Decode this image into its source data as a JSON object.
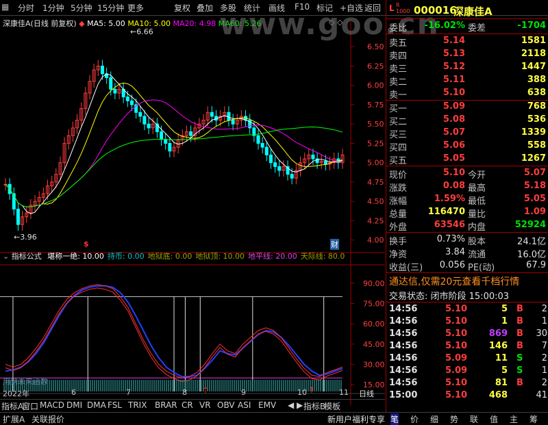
{
  "toolbar": {
    "items": [
      "分时",
      "1分钟",
      "5分钟",
      "15分钟",
      "更多",
      "复权",
      "叠加",
      "多股",
      "统计",
      "画线",
      "F10",
      "标记",
      "+自选",
      "返回"
    ]
  },
  "watermark": "www.goo.cn",
  "chart_header": {
    "stock": "深康佳A",
    "mode": "(日线 前复权)",
    "ma5": "MA5: 5.00",
    "ma10": "MA10: 5.00",
    "ma20": "MA20: 4.98",
    "ma60": "MA60: 5.26"
  },
  "annotations": {
    "high": "6.66",
    "low": "3.96",
    "marker_s": "$",
    "marker_cai": "财"
  },
  "indicator_header": {
    "title": "指标公式",
    "params": [
      {
        "text": "堪称一绝: 10.00",
        "color": "#ffffff"
      },
      {
        "text": "持币: 0.00",
        "color": "#00c8c8"
      },
      {
        "text": "地狱底: 0.00",
        "color": "#a0a000"
      },
      {
        "text": "地狱顶: 10.00",
        "color": "#a0a000"
      },
      {
        "text": "地平线: 20.00",
        "color": "#e040e0"
      },
      {
        "text": "天际线: 80.0",
        "color": "#a0a000"
      }
    ],
    "subtext": "用到未来函数"
  },
  "x_axis": {
    "year": "2022年",
    "months": [
      "6",
      "7",
      "8",
      "9",
      "10",
      "11"
    ],
    "period": "日线"
  },
  "chart_data": [
    {
      "type": "candlestick",
      "title": "深康佳A (日线 前复权)",
      "ylim": [
        3.9,
        6.75
      ],
      "y_ticks": [
        4.0,
        4.25,
        4.5,
        4.75,
        5.0,
        5.25,
        5.5,
        5.75,
        6.0,
        6.25,
        6.5
      ],
      "close": [
        4.72,
        4.6,
        4.4,
        4.2,
        4.3,
        4.35,
        4.45,
        4.5,
        4.55,
        4.6,
        4.7,
        4.75,
        4.85,
        5.0,
        5.25,
        5.35,
        5.45,
        5.55,
        5.7,
        5.9,
        6.05,
        6.2,
        6.25,
        6.15,
        6.1,
        5.95,
        5.9,
        5.95,
        5.85,
        5.8,
        5.75,
        5.65,
        5.6,
        5.5,
        5.45,
        5.5,
        5.4,
        5.3,
        5.25,
        5.15,
        5.2,
        5.3,
        5.35,
        5.4,
        5.35,
        5.45,
        5.5,
        5.55,
        5.65,
        5.6,
        5.55,
        5.6,
        5.65,
        5.55,
        5.5,
        5.55,
        5.6,
        5.55,
        5.45,
        5.35,
        5.25,
        5.2,
        5.1,
        5.0,
        4.95,
        4.9,
        4.95,
        4.85,
        4.8,
        4.9,
        5.0,
        5.05,
        5.1,
        5.05,
        5.0,
        5.02,
        4.98,
        5.0,
        5.05,
        5.0,
        5.1
      ],
      "series": [
        {
          "name": "MA5",
          "color": "#ffffff"
        },
        {
          "name": "MA10",
          "color": "#ffff00"
        },
        {
          "name": "MA20",
          "color": "#ff00ff"
        },
        {
          "name": "MA60",
          "color": "#00ff00"
        }
      ]
    },
    {
      "type": "line",
      "title": "指标公式",
      "ylim": [
        10,
        100
      ],
      "y_ticks": [
        15.0,
        30.0,
        45.0,
        60.0,
        75.0,
        90.0
      ],
      "hlines": [
        {
          "value": 80,
          "color": "#c0c0c0"
        },
        {
          "value": 20,
          "color": "#e040e0"
        }
      ],
      "k": [
        30,
        28,
        30,
        35,
        42,
        50,
        60,
        70,
        78,
        83,
        86,
        88,
        89,
        88,
        86,
        80,
        72,
        60,
        48,
        38,
        30,
        25,
        22,
        20,
        21,
        24,
        30,
        38,
        45,
        40,
        38,
        45,
        50,
        55,
        57,
        55,
        50,
        42,
        34,
        27,
        22,
        21,
        24,
        26,
        28
      ],
      "d": [
        25,
        26,
        28,
        32,
        38,
        46,
        56,
        66,
        75,
        81,
        85,
        87,
        88,
        88,
        87,
        83,
        76,
        66,
        55,
        44,
        35,
        28,
        24,
        21,
        21,
        22,
        27,
        33,
        40,
        38,
        37,
        42,
        47,
        52,
        55,
        54,
        50,
        44,
        37,
        30,
        25,
        22,
        23,
        25,
        27
      ],
      "signals": [
        2,
        22,
        45,
        48,
        52,
        66,
        85
      ]
    }
  ],
  "quote": {
    "code": "000016",
    "name": "深康佳A",
    "weibi_label": "委比",
    "weibi": "-16.02%",
    "weicha_label": "委差",
    "weicha": "-1704",
    "sells": [
      {
        "label": "卖五",
        "price": "5.14",
        "vol": "1581"
      },
      {
        "label": "卖四",
        "price": "5.13",
        "vol": "2118"
      },
      {
        "label": "卖三",
        "price": "5.12",
        "vol": "1447"
      },
      {
        "label": "卖二",
        "price": "5.11",
        "vol": "388"
      },
      {
        "label": "卖一",
        "price": "5.10",
        "vol": "638"
      }
    ],
    "buys": [
      {
        "label": "买一",
        "price": "5.09",
        "vol": "768"
      },
      {
        "label": "买二",
        "price": "5.08",
        "vol": "536"
      },
      {
        "label": "买三",
        "price": "5.07",
        "vol": "1339"
      },
      {
        "label": "买四",
        "price": "5.06",
        "vol": "558"
      },
      {
        "label": "买五",
        "price": "5.05",
        "vol": "1267"
      }
    ],
    "stats": [
      {
        "l1": "现价",
        "v1": "5.10",
        "c1": "red",
        "l2": "今开",
        "v2": "5.07",
        "c2": "red"
      },
      {
        "l1": "涨跌",
        "v1": "0.08",
        "c1": "red",
        "l2": "最高",
        "v2": "5.18",
        "c2": "red"
      },
      {
        "l1": "涨幅",
        "v1": "1.59%",
        "c1": "red",
        "l2": "最低",
        "v2": "5.05",
        "c2": "red"
      },
      {
        "l1": "总量",
        "v1": "116470",
        "c1": "yellow",
        "l2": "量比",
        "v2": "1.09",
        "c2": "red"
      },
      {
        "l1": "外盘",
        "v1": "63546",
        "c1": "red",
        "l2": "内盘",
        "v2": "52924",
        "c2": "green"
      }
    ],
    "stats2": [
      {
        "l1": "换手",
        "v1": "0.73%",
        "l2": "股本",
        "v2": "24.1亿"
      },
      {
        "l1": "净资",
        "v1": "3.84",
        "l2": "流通",
        "v2": "16.0亿"
      },
      {
        "l1": "收益(三)",
        "v1": "0.056",
        "l2": "PE(动)",
        "v2": "67.9"
      }
    ],
    "promo": "通达信,仅需20元查看千档行情",
    "trade_status": "交易状态: 闭市阶段 15:00:03",
    "ticks": [
      {
        "t": "14:56",
        "p": "5.10",
        "v": "5",
        "d": "B",
        "n": "2",
        "pc": "red",
        "vc": "yellow",
        "dc": "red"
      },
      {
        "t": "14:56",
        "p": "5.10",
        "v": "1",
        "d": "B",
        "n": "1",
        "pc": "red",
        "vc": "yellow",
        "dc": "red"
      },
      {
        "t": "14:56",
        "p": "5.10",
        "v": "869",
        "d": "B",
        "n": "30",
        "pc": "red",
        "vc": "purple",
        "dc": "red"
      },
      {
        "t": "14:56",
        "p": "5.10",
        "v": "146",
        "d": "B",
        "n": "7",
        "pc": "red",
        "vc": "yellow",
        "dc": "red"
      },
      {
        "t": "14:56",
        "p": "5.09",
        "v": "11",
        "d": "S",
        "n": "2",
        "pc": "red",
        "vc": "yellow",
        "dc": "green"
      },
      {
        "t": "14:56",
        "p": "5.09",
        "v": "5",
        "d": "S",
        "n": "1",
        "pc": "red",
        "vc": "yellow",
        "dc": "green"
      },
      {
        "t": "14:56",
        "p": "5.10",
        "v": "81",
        "d": "B",
        "n": "2",
        "pc": "red",
        "vc": "yellow",
        "dc": "red"
      },
      {
        "t": "15:00",
        "p": "5.10",
        "v": "468",
        "d": "",
        "n": "41",
        "pc": "red",
        "vc": "yellow",
        "dc": "red"
      }
    ]
  },
  "indicator_tabs": [
    "指标A",
    "窗口",
    "MACD",
    "DMI",
    "DMA",
    "FSL",
    "TRIX",
    "BRAR",
    "CR",
    "VR",
    "OBV",
    "ASI",
    "EMV",
    "指标B",
    "模板"
  ],
  "bottom": {
    "left": [
      "扩展A",
      "关联报价"
    ],
    "news": "新用户福利专享",
    "right_tabs": [
      "笔",
      "价",
      "细",
      "势",
      "联",
      "值",
      "主",
      "筹"
    ]
  }
}
